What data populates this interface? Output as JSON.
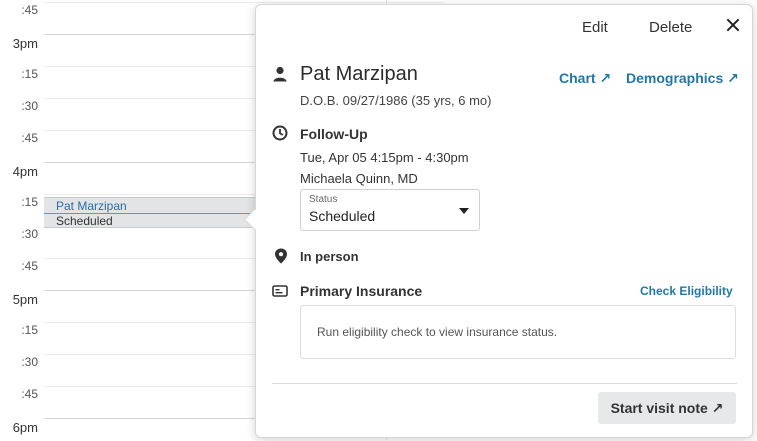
{
  "calendar": {
    "time_labels": [
      ":45",
      "3pm",
      ":15",
      ":30",
      ":45",
      "4pm",
      ":15",
      ":30",
      ":45",
      "5pm",
      ":15",
      ":30",
      ":45",
      "6pm"
    ],
    "appointment": {
      "name": "Pat Marzipan",
      "status": "Scheduled"
    }
  },
  "popover": {
    "actions": {
      "edit": "Edit",
      "delete": "Delete"
    },
    "patient": {
      "name": "Pat Marzipan",
      "dob": "D.O.B. 09/27/1986 (35 yrs, 6 mo)",
      "chart_link": "Chart ↗",
      "demographics_link": "Demographics ↗"
    },
    "visit": {
      "type": "Follow-Up",
      "datetime": "Tue, Apr 05  4:15pm - 4:30pm",
      "provider": "Michaela Quinn, MD",
      "status_label": "Status",
      "status_value": "Scheduled"
    },
    "location": "In person",
    "insurance": {
      "title": "Primary Insurance",
      "check_link": "Check Eligibility",
      "message": "Run eligibility check to view insurance status."
    },
    "start_button": "Start visit note ↗"
  }
}
